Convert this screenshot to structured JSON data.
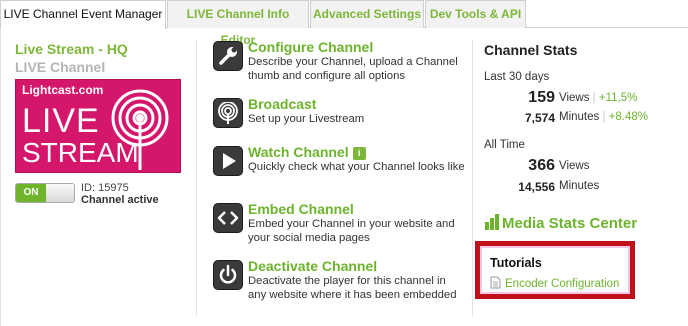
{
  "tabs": [
    {
      "label": "LIVE Channel Event Manager",
      "active": true
    },
    {
      "label": "LIVE Channel Info Editor",
      "active": false
    },
    {
      "label": "Advanced Settings",
      "active": false
    },
    {
      "label": "Dev Tools & API",
      "active": false
    }
  ],
  "channel": {
    "name": "Live Stream - HQ",
    "type": "LIVE Channel",
    "thumb_brand": "Lightcast.com",
    "thumb_line1": "LIVE",
    "thumb_line2": "STREAM",
    "toggle_label": "ON",
    "id_text": "ID: 15975",
    "status": "Channel active"
  },
  "actions": [
    {
      "title": "Configure Channel",
      "desc": "Describe your Channel, upload a Channel thumb and configure all options",
      "icon": "wrench-icon"
    },
    {
      "title": "Broadcast",
      "desc": "Set up your Livestream",
      "icon": "broadcast-icon"
    },
    {
      "title": "Watch Channel",
      "badge": "i",
      "desc": "Quickly check what your Channel looks like",
      "icon": "play-icon"
    },
    {
      "title": "Embed Channel",
      "desc": "Embed your Channel in your website and your social media pages",
      "icon": "embed-code-icon"
    },
    {
      "title": "Deactivate Channel",
      "desc": "Deactivate the player for this channel in any website where it has been embedded",
      "icon": "power-icon"
    }
  ],
  "stats": {
    "title": "Channel Stats",
    "last30_label": "Last 30 days",
    "last30_views": "159",
    "views_label": "Views",
    "last30_views_change": "+11,5%",
    "last30_minutes": "7,574",
    "minutes_label": "Minutes",
    "last30_minutes_change": "+8.48%",
    "alltime_label": "All Time",
    "alltime_views": "366",
    "alltime_minutes": "14,556"
  },
  "media_stats_center": "Media Stats Center",
  "tutorials": {
    "title": "Tutorials",
    "link": "Encoder Configuration"
  },
  "colors": {
    "accent_green": "#6db42d",
    "brand_pink": "#d4176b",
    "highlight_red": "#c0101a"
  }
}
